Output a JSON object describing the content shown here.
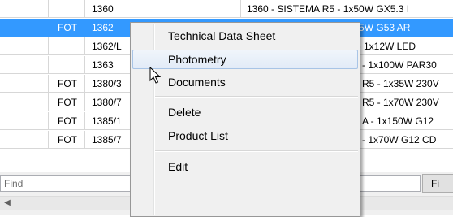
{
  "table": {
    "rows": [
      {
        "tag": "",
        "code": "1360",
        "desc": "1360 - SISTEMA R5 - 1x50W GX5.3 I",
        "selected": false
      },
      {
        "tag": "FOT",
        "code": "1362",
        "desc": "1362 - SISTEMA R5 - 1x75W G53 AR",
        "selected": true
      },
      {
        "tag": "",
        "code": "1362/L",
        "desc": "R5 - 1x12W LED",
        "selected": false
      },
      {
        "tag": "",
        "code": "1363",
        "desc": "- 1x100W PAR30",
        "selected": false
      },
      {
        "tag": "FOT",
        "code": "1380/3",
        "desc": "R5 - 1x35W 230V",
        "selected": false
      },
      {
        "tag": "FOT",
        "code": "1380/7",
        "desc": "R5 - 1x70W 230V",
        "selected": false
      },
      {
        "tag": "FOT",
        "code": "1385/1",
        "desc": "A - 1x150W G12",
        "selected": false
      },
      {
        "tag": "FOT",
        "code": "1385/7",
        "desc": "- 1x70W G12 CD",
        "selected": false
      }
    ]
  },
  "find_bar": {
    "placeholder": "Find",
    "button_label": "Fi"
  },
  "context_menu": {
    "items": [
      {
        "label": "Technical Data Sheet"
      },
      {
        "label": "Photometry"
      },
      {
        "label": "Documents"
      },
      {
        "label": "Delete"
      },
      {
        "label": "Product List"
      },
      {
        "label": "Edit"
      }
    ],
    "hovered_item": "Photometry"
  },
  "colors": {
    "selection": "#3399ff",
    "menu_hover_border": "#a8c4e6",
    "menu_background": "#f0f0f0"
  }
}
